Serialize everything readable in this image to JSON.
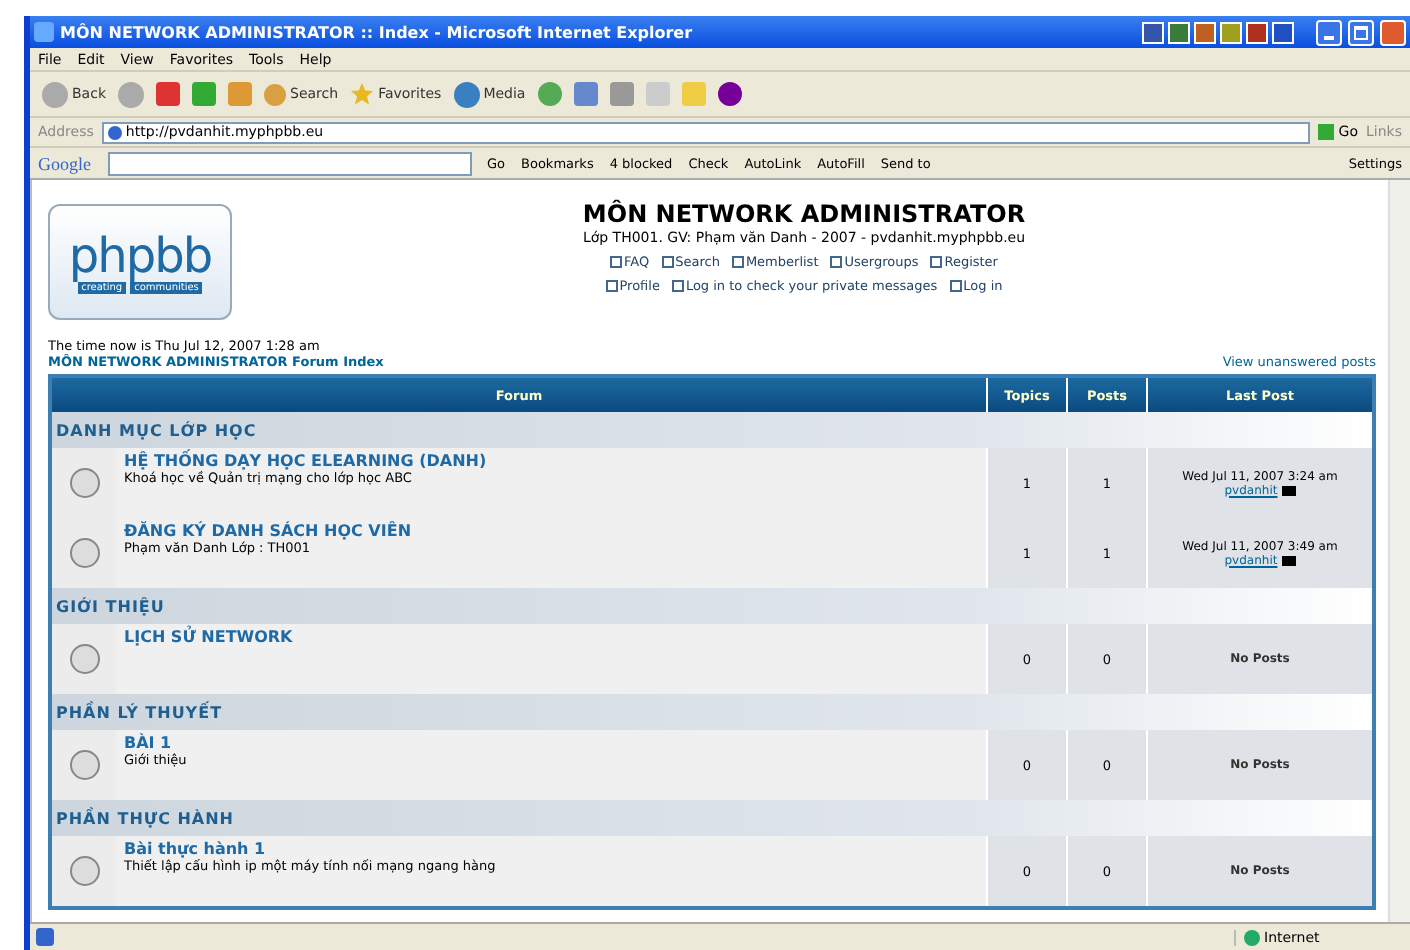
{
  "window": {
    "title": "MÔN NETWORK ADMINISTRATOR :: Index - Microsoft Internet Explorer"
  },
  "menu": [
    "File",
    "Edit",
    "View",
    "Favorites",
    "Tools",
    "Help"
  ],
  "toolbar": {
    "back": "Back",
    "search": "Search",
    "favorites": "Favorites",
    "media": "Media"
  },
  "address": {
    "label": "Address",
    "value": "http://pvdanhit.myphpbb.eu",
    "go": "Go",
    "links": "Links"
  },
  "google_bar": {
    "logo": "Google",
    "items": [
      "Go",
      "Bookmarks",
      "4 blocked",
      "Check",
      "AutoLink",
      "AutoFill",
      "Send to"
    ],
    "settings": "Settings"
  },
  "header": {
    "logo": "phpbb",
    "logo_tagline": [
      "creating",
      "communities"
    ],
    "title": "MÔN NETWORK ADMINISTRATOR",
    "subtitle": "Lớp TH001. GV: Phạm văn Danh - 2007 - pvdanhit.myphpbb.eu",
    "links": [
      [
        "FAQ",
        "Search",
        "Memberlist",
        "Usergroups",
        "Register"
      ],
      [
        "Profile",
        "Log in to check your private messages",
        "Log in"
      ]
    ]
  },
  "time": "The time now is Thu Jul 12, 2007 1:28 am",
  "index_link": "MÔN NETWORK ADMINISTRATOR Forum Index",
  "unanswered": "View unanswered posts",
  "table": {
    "columns": [
      "Forum",
      "Topics",
      "Posts",
      "Last Post"
    ],
    "categories": [
      {
        "name": "DANH MỤC LỚP HỌC",
        "forums": [
          {
            "name": "HỆ THỐNG DẠY HỌC ELEARNING (DANH)",
            "description": "Khoá học về Quản trị mạng cho lớp học ABC",
            "topics": "1",
            "posts": "1",
            "last_post": {
              "date": "Wed Jul 11, 2007 3:24 am",
              "user": "pvdanhit"
            }
          },
          {
            "name": "ĐĂNG KÝ DANH SÁCH HỌC VIÊN",
            "description": "Phạm văn Danh Lớp : TH001",
            "topics": "1",
            "posts": "1",
            "last_post": {
              "date": "Wed Jul 11, 2007 3:49 am",
              "user": "pvdanhit"
            }
          }
        ]
      },
      {
        "name": "GIỚI THIỆU",
        "forums": [
          {
            "name": "LỊCH SỬ NETWORK",
            "topics": "0",
            "posts": "0",
            "last_post": {
              "none": "No Posts"
            }
          }
        ]
      },
      {
        "name": "PHẦN LÝ THUYẾT",
        "forums": [
          {
            "name": "BÀI 1",
            "description": "Giới thiệu",
            "topics": "0",
            "posts": "0",
            "last_post": {
              "none": "No Posts"
            }
          }
        ]
      },
      {
        "name": "PHẦN THỰC HÀNH",
        "forums": [
          {
            "name": "Bài thực hành 1",
            "description": "Thiết lập cấu hình ip một máy tính nối mạng ngang hàng",
            "topics": "0",
            "posts": "0",
            "last_post": {
              "none": "No Posts"
            }
          }
        ]
      }
    ]
  },
  "status_bar": {
    "zone": "Internet"
  }
}
